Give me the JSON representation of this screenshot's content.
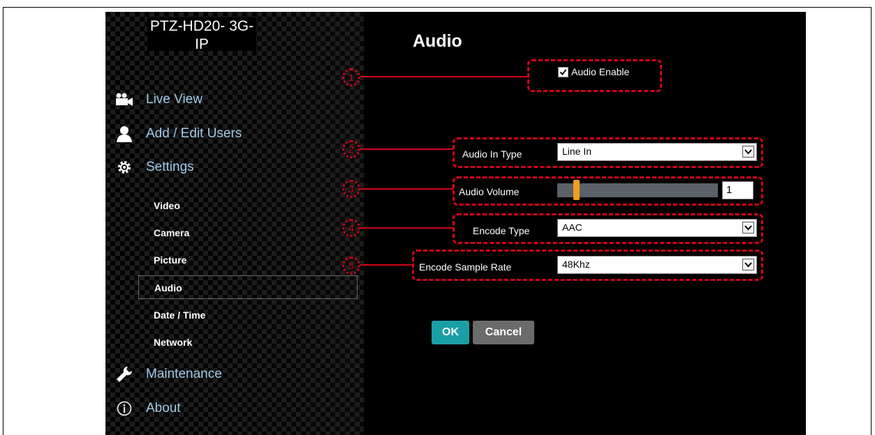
{
  "device": {
    "name": "PTZ-HD20-\n3G-IP"
  },
  "nav": {
    "live_view": "Live View",
    "add_edit_users": "Add / Edit Users",
    "settings": "Settings",
    "sub": [
      "Video",
      "Camera",
      "Picture",
      "Audio",
      "Date / Time",
      "Network"
    ],
    "maintenance": "Maintenance",
    "about": "About"
  },
  "page": {
    "title": "Audio"
  },
  "form": {
    "audio_enable": {
      "label": "Audio Enable",
      "checked": true
    },
    "audio_in_type": {
      "label": "Audio In Type",
      "value": "Line In"
    },
    "audio_volume": {
      "label": "Audio Volume",
      "value": "1"
    },
    "encode_type": {
      "label": "Encode Type",
      "value": "AAC"
    },
    "encode_sample_rate": {
      "label": "Encode Sample Rate",
      "value": "48Khz"
    }
  },
  "callouts": [
    "1",
    "2",
    "3",
    "4",
    "5"
  ],
  "buttons": {
    "ok": "OK",
    "cancel": "Cancel"
  },
  "colors": {
    "accent": "#1a9fa6",
    "callout": "#d0021b",
    "nav_text": "#9fcbe8",
    "slider_thumb": "#f0a020"
  }
}
